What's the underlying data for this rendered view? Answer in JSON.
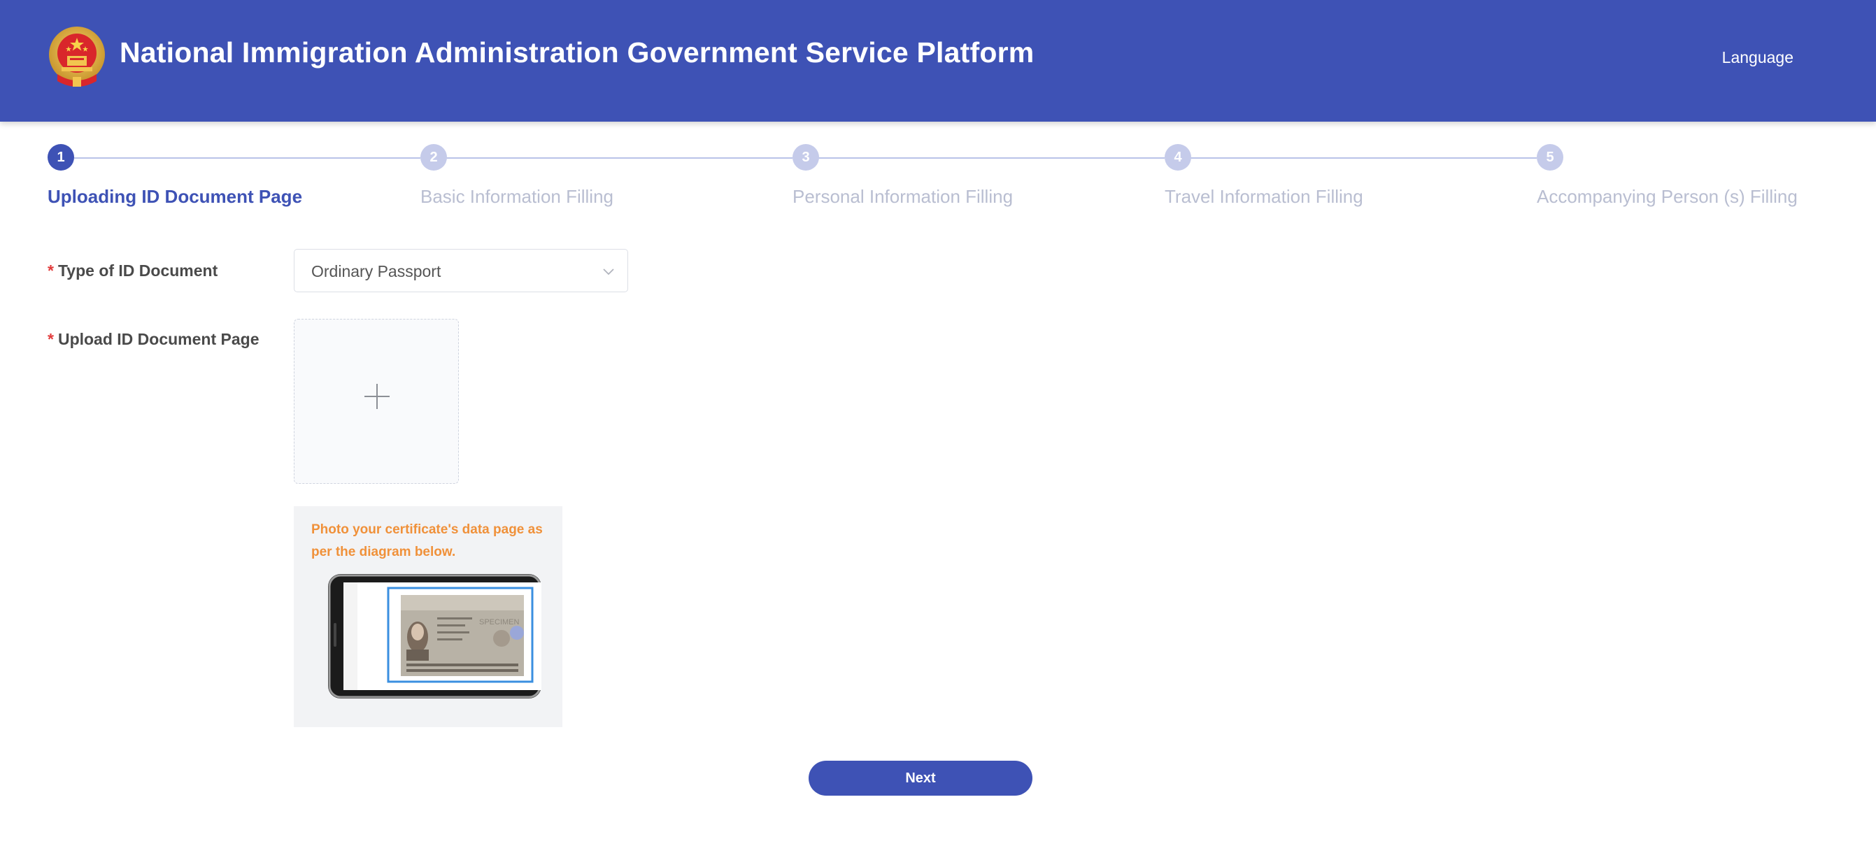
{
  "header": {
    "title": "National Immigration Administration Government Service Platform",
    "language_label": "Language"
  },
  "steps": [
    {
      "number": "1",
      "label": "Uploading ID Document Page",
      "active": true
    },
    {
      "number": "2",
      "label": "Basic Information Filling",
      "active": false
    },
    {
      "number": "3",
      "label": "Personal Information Filling",
      "active": false
    },
    {
      "number": "4",
      "label": "Travel Information Filling",
      "active": false
    },
    {
      "number": "5",
      "label": "Accompanying Person (s) Filling",
      "active": false
    }
  ],
  "form": {
    "required_mark": "*",
    "id_type_label": "Type of ID Document",
    "id_type_value": "Ordinary Passport",
    "upload_label": "Upload ID Document Page",
    "hint": "Photo your certificate's data page as per the diagram below.",
    "specimen_text": "SPECIMEN",
    "next_label": "Next"
  },
  "colors": {
    "primary": "#3e52b5",
    "step_inactive": "#c5cbea",
    "hint": "#f0913a",
    "required": "#e23c3c"
  }
}
